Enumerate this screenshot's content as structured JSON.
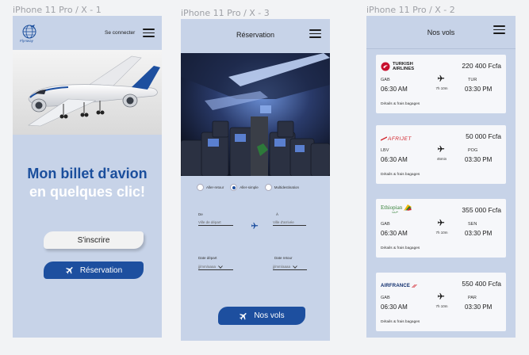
{
  "frames": [
    {
      "label": "iPhone 11 Pro / X - 1"
    },
    {
      "label": "iPhone 11 Pro / X - 3"
    },
    {
      "label": "iPhone 11 Pro / X - 2"
    }
  ],
  "home": {
    "logo_text": "FlyAway",
    "connect_label": "Se connecter",
    "title_line1": "Mon billet d'avion",
    "title_line2": "en quelques clic!",
    "signup_label": "S'inscrire",
    "reservation_label": "Réservation"
  },
  "reservation": {
    "title": "Réservation",
    "trip_types": [
      {
        "label": "Aller-retour",
        "selected": false
      },
      {
        "label": "Aller-simple",
        "selected": true
      },
      {
        "label": "Multidestination",
        "selected": false
      }
    ],
    "from_label": "De",
    "from_placeholder": "Ville de départ",
    "to_label": "À",
    "to_placeholder": "Ville d'arrivée",
    "depart_date_label": "Date départ",
    "return_date_label": "Date retour",
    "date_placeholder": "jj/mm/aaaa",
    "submit_label": "Nos vols"
  },
  "flights": {
    "title": "Nos vols",
    "details_label": "Détails & frais bagages",
    "items": [
      {
        "airline": "Turkish Airlines",
        "logo": [
          "TURKISH",
          "AIRLINES"
        ],
        "price": "220 400 Fcfa",
        "from": "GAB",
        "dep_time": "06:30 AM",
        "duration": "7h 10m",
        "to": "TUR",
        "arr_time": "03:30 PM"
      },
      {
        "airline": "Afrijet",
        "logo": [
          "AFRIJET"
        ],
        "price": "50 000 Fcfa",
        "from": "LBV",
        "dep_time": "06:30 AM",
        "duration": "45min",
        "to": "POG",
        "arr_time": "03:30 PM"
      },
      {
        "airline": "Ethiopian Airlines",
        "logo": [
          "Ethiopian",
          "ፍጹም"
        ],
        "price": "355 000 Fcfa",
        "from": "GAB",
        "dep_time": "06:30 AM",
        "duration": "7h 10m",
        "to": "SEN",
        "arr_time": "03:30 PM"
      },
      {
        "airline": "Air France",
        "logo": [
          "AIRFRANCE"
        ],
        "price": "550 400 Fcfa",
        "from": "GAB",
        "dep_time": "06:30 AM",
        "duration": "7h 10m",
        "to": "PAR",
        "arr_time": "03:30 PM"
      }
    ]
  },
  "colors": {
    "phone_bg": "#c7d3e8",
    "brand_blue": "#1d4f9f",
    "card_bg": "#f6f7fa",
    "turkish_red": "#c8102e",
    "afrijet_red": "#d2232a",
    "ethiopian_green": "#2e7d32"
  },
  "icons": [
    "hamburger-menu-icon",
    "airplane-icon",
    "globe-logo-icon",
    "calendar-chevron-icon"
  ]
}
